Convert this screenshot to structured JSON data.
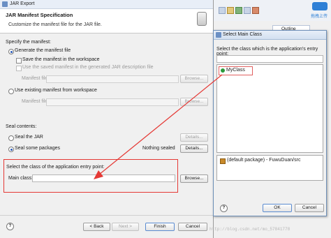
{
  "jar_window": {
    "title": "JAR Export",
    "page_title": "JAR Manifest Specification",
    "page_subtitle": "Customize the manifest file for the JAR file.",
    "specify_label": "Specify the manifest:",
    "generate_radio": "Generate the manifest file",
    "save_checkbox": "Save the manifest in the workspace",
    "use_saved_checkbox": "Use the saved manifest in the generated JAR description file",
    "manifest_file_label": "Manifest file:",
    "browse_label": "Browse...",
    "use_existing_radio": "Use existing manifest from workspace",
    "manifest_file_label2": "Manifest file:",
    "seal_contents_label": "Seal contents:",
    "seal_jar_radio": "Seal the JAR",
    "details_label": "Details...",
    "seal_some_radio": "Seal some packages",
    "nothing_sealed": "Nothing sealed",
    "details_label2": "Details...",
    "entry_point_label": "Select the class of the application entry point:",
    "main_class_label": "Main class:",
    "main_class_value": "",
    "browse_label2": "Browse...",
    "back_button": "< Back",
    "next_button": "Next >",
    "finish_button": "Finish",
    "cancel_button": "Cancel",
    "help_glyph": "?"
  },
  "editor": {
    "outline_tab": "Outline",
    "corner_text": "拖拽上传"
  },
  "select_main_class": {
    "title": "Select Main Class",
    "prompt": "Select the class which is the application's entry point:",
    "search_value": "",
    "classes": [
      "MyClass"
    ],
    "packages": [
      "(default package) - FuwuDuan/src"
    ],
    "ok_button": "OK",
    "cancel_button": "Cancel",
    "help_glyph": "?"
  },
  "annotation": {
    "color": "#e53935"
  },
  "watermark": {
    "text": "http://blog.csdn.net/mo_57841778"
  }
}
